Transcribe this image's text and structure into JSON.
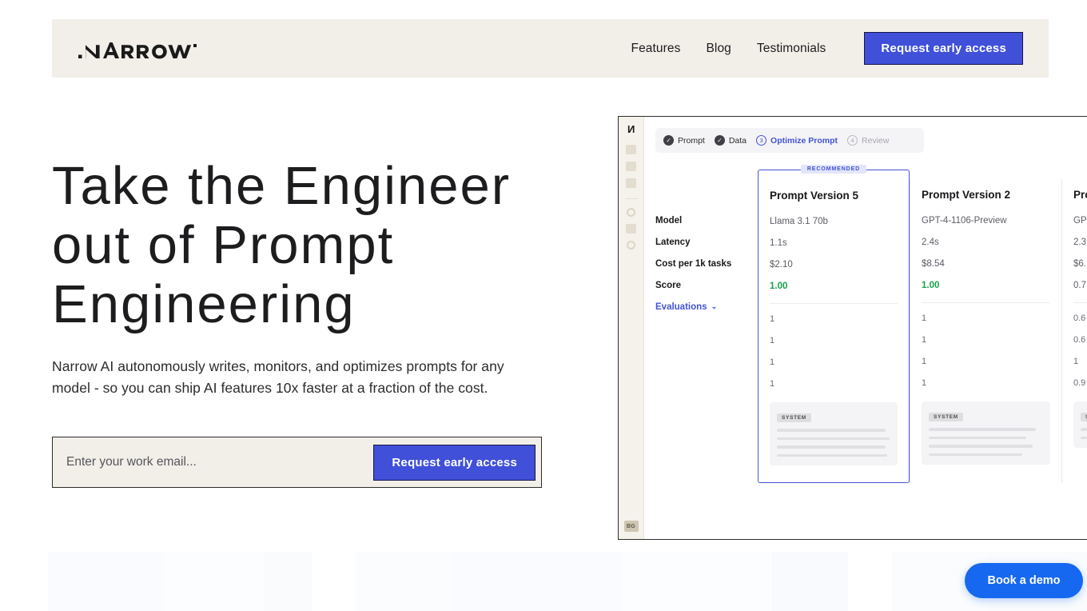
{
  "brand": {
    "logo_text": "NARROW"
  },
  "nav": {
    "links": [
      {
        "label": "Features"
      },
      {
        "label": "Blog"
      },
      {
        "label": "Testimonials"
      }
    ],
    "cta_label": "Request early access"
  },
  "hero": {
    "headline": "Take the Engineer\nout of Prompt\nEngineering",
    "subhead": "Narrow AI autonomously writes, monitors, and optimizes prompts for any model - so you can ship AI features 10x faster at a fraction of the cost.",
    "email_placeholder": "Enter your work email...",
    "email_value": "",
    "form_cta_label": "Request early access"
  },
  "app": {
    "sidebar": {
      "logo_text": "N",
      "avatar_initials": "BG",
      "icons": [
        "dashboard-icon",
        "experiments-icon",
        "datasets-icon",
        "settings-icon",
        "library-icon",
        "integrations-icon"
      ]
    },
    "stepper": [
      {
        "marker": "✓",
        "label": "Prompt",
        "state": "done"
      },
      {
        "marker": "✓",
        "label": "Data",
        "state": "done"
      },
      {
        "marker": "3",
        "label": "Optimize Prompt",
        "state": "active"
      },
      {
        "marker": "4",
        "label": "Review",
        "state": "todo"
      }
    ],
    "row_labels": [
      "Model",
      "Latency",
      "Cost per 1k tasks",
      "Score"
    ],
    "evaluations_label": "Evaluations",
    "recommended_badge": "RECOMMENDED",
    "system_badge": "SYSTEM",
    "columns": [
      {
        "title": "Prompt Version 5",
        "model": "Llama 3.1 70b",
        "latency": "1.1s",
        "cost": "$2.10",
        "score": "1.00",
        "score_high": true,
        "evals": [
          "1",
          "1",
          "1",
          "1"
        ],
        "recommended": true
      },
      {
        "title": "Prompt Version 2",
        "model": "GPT-4-1106-Preview",
        "latency": "2.4s",
        "cost": "$8.54",
        "score": "1.00",
        "score_high": true,
        "evals": [
          "1",
          "1",
          "1",
          "1"
        ],
        "recommended": false
      },
      {
        "title": "Pro",
        "model": "GPT",
        "latency": "2.3",
        "cost": "$6.",
        "score": "0.7",
        "score_high": false,
        "evals": [
          "0.6",
          "0.6",
          "1",
          "0.9"
        ],
        "recommended": false
      }
    ]
  },
  "demo": {
    "label": "Book a demo"
  },
  "colors": {
    "header_bg": "#f2efe9",
    "primary_button": "#4050d8",
    "demo_button": "#1668f0",
    "accent_blue": "#4353d6",
    "score_green": "#16a34a",
    "headline": "#1d1d1f"
  }
}
